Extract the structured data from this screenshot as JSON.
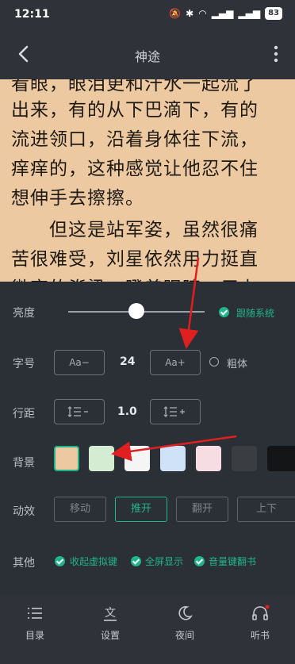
{
  "status": {
    "time": "12:11",
    "battery": "83"
  },
  "header": {
    "title": "神途"
  },
  "reading": {
    "lines": [
      "看眼，眼泪更和汗水一起流了",
      "出来，有的从下巴滴下，有的",
      "流进领口，沿着身体往下流，",
      "痒痒的，这种感觉让他忍不住",
      "想伸手去擦擦。",
      "　　但这是站军姿，虽然很痛",
      "苦很难受，刘星依然用力挺直",
      "微弯的脊梁，瞪着眼睛，用力"
    ]
  },
  "settings": {
    "brightness_label": "亮度",
    "brightness_level": 0.5,
    "follow_system": "跟随系统",
    "font_label": "字号",
    "font_decrease": "Aa−",
    "font_size": "24",
    "font_increase": "Aa+",
    "bold_label": "粗体",
    "spacing_label": "行距",
    "spacing_value": "1.0",
    "background_label": "背景",
    "background_colors": [
      "#ecc9a1",
      "#d4ecd2",
      "#f5f5f5",
      "#cfe2f8",
      "#f6dde4",
      "#3a3d42",
      "#141516"
    ],
    "animation_label": "动效",
    "animations": [
      "移动",
      "推开",
      "翻开",
      "上下"
    ],
    "other_label": "其他",
    "other_options": [
      "收起虚拟键",
      "全屏显示",
      "音量键翻书"
    ]
  },
  "nav": {
    "catalog": "目录",
    "settings": "设置",
    "night": "夜间",
    "listen": "听书"
  },
  "colors": {
    "accent": "#21b58a",
    "arrow": "#e02020"
  }
}
